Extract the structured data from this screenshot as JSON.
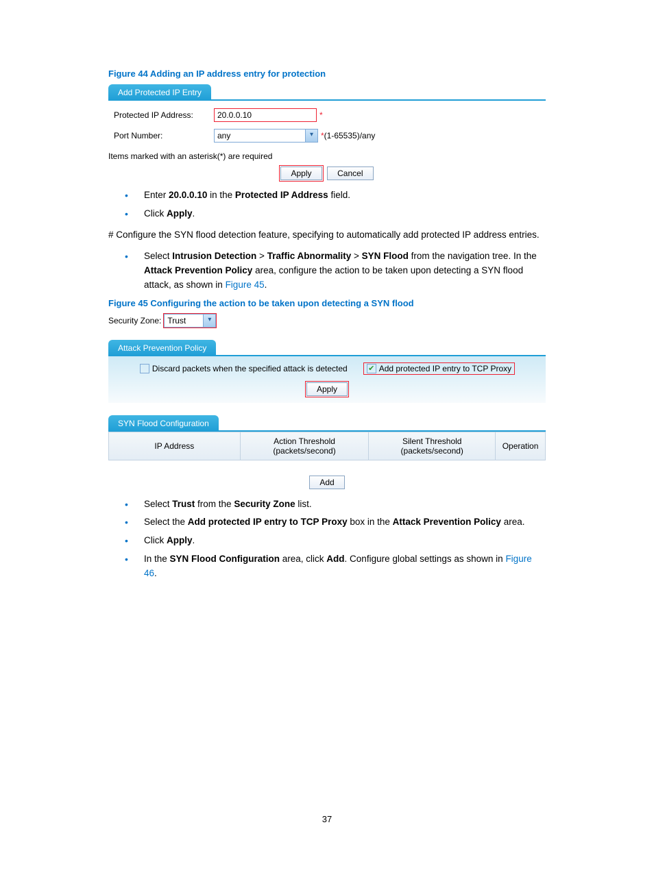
{
  "figure44": {
    "caption": "Figure 44 Adding an IP address entry for protection",
    "tab_title": "Add Protected IP Entry",
    "ip_label": "Protected IP Address:",
    "ip_value": "20.0.0.10",
    "asterisk": "*",
    "port_label": "Port Number:",
    "port_value": "any",
    "port_hint": "*(1-65535)/any",
    "note": "Items marked with an asterisk(*) are required",
    "apply": "Apply",
    "cancel": "Cancel"
  },
  "bullets1": {
    "b1_pre": "Enter ",
    "b1_val": "20.0.0.10",
    "b1_mid": " in the ",
    "b1_field": "Protected IP Address",
    "b1_post": " field.",
    "b2_pre": "Click ",
    "b2_btn": "Apply",
    "b2_post": "."
  },
  "para1": "# Configure the SYN flood detection feature, specifying to automatically add protected IP address entries.",
  "bullets2": {
    "pre": "Select ",
    "nav1": "Intrusion Detection",
    "gt1": " > ",
    "nav2": "Traffic Abnormality",
    "gt2": " > ",
    "nav3": "SYN Flood",
    "mid1": " from the navigation tree. In the ",
    "area": "Attack Prevention Policy",
    "mid2": " area, configure the action to be taken upon detecting a SYN flood attack, as shown in ",
    "figlink": "Figure 45",
    "post": "."
  },
  "figure45": {
    "caption": "Figure 45 Configuring the action to be taken upon detecting a SYN flood",
    "sz_label": "Security Zone:",
    "sz_value": "Trust",
    "policy_tab": "Attack Prevention Policy",
    "chk1_label": "Discard packets when the specified attack is detected",
    "chk2_label": "Add protected IP entry to TCP Proxy",
    "apply": "Apply",
    "config_tab": "SYN Flood Configuration",
    "col_ip": "IP Address",
    "col_action_1": "Action Threshold",
    "col_action_2": "(packets/second)",
    "col_silent_1": "Silent Threshold",
    "col_silent_2": "(packets/second)",
    "col_op": "Operation",
    "add": "Add"
  },
  "bullets3": {
    "b1_pre": "Select ",
    "b1_trust": "Trust",
    "b1_mid": " from the ",
    "b1_sz": "Security Zone",
    "b1_post": " list.",
    "b2_pre": "Select the ",
    "b2_box": "Add protected IP entry to TCP Proxy",
    "b2_mid": " box in the ",
    "b2_area": "Attack Prevention Policy",
    "b2_post": " area.",
    "b3_pre": "Click ",
    "b3_btn": "Apply",
    "b3_post": ".",
    "b4_pre": "In the ",
    "b4_area": "SYN Flood Configuration",
    "b4_mid": " area, click ",
    "b4_add": "Add",
    "b4_mid2": ". Configure global settings as shown in ",
    "b4_fig": "Figure 46",
    "b4_post": "."
  },
  "page_number": "37"
}
